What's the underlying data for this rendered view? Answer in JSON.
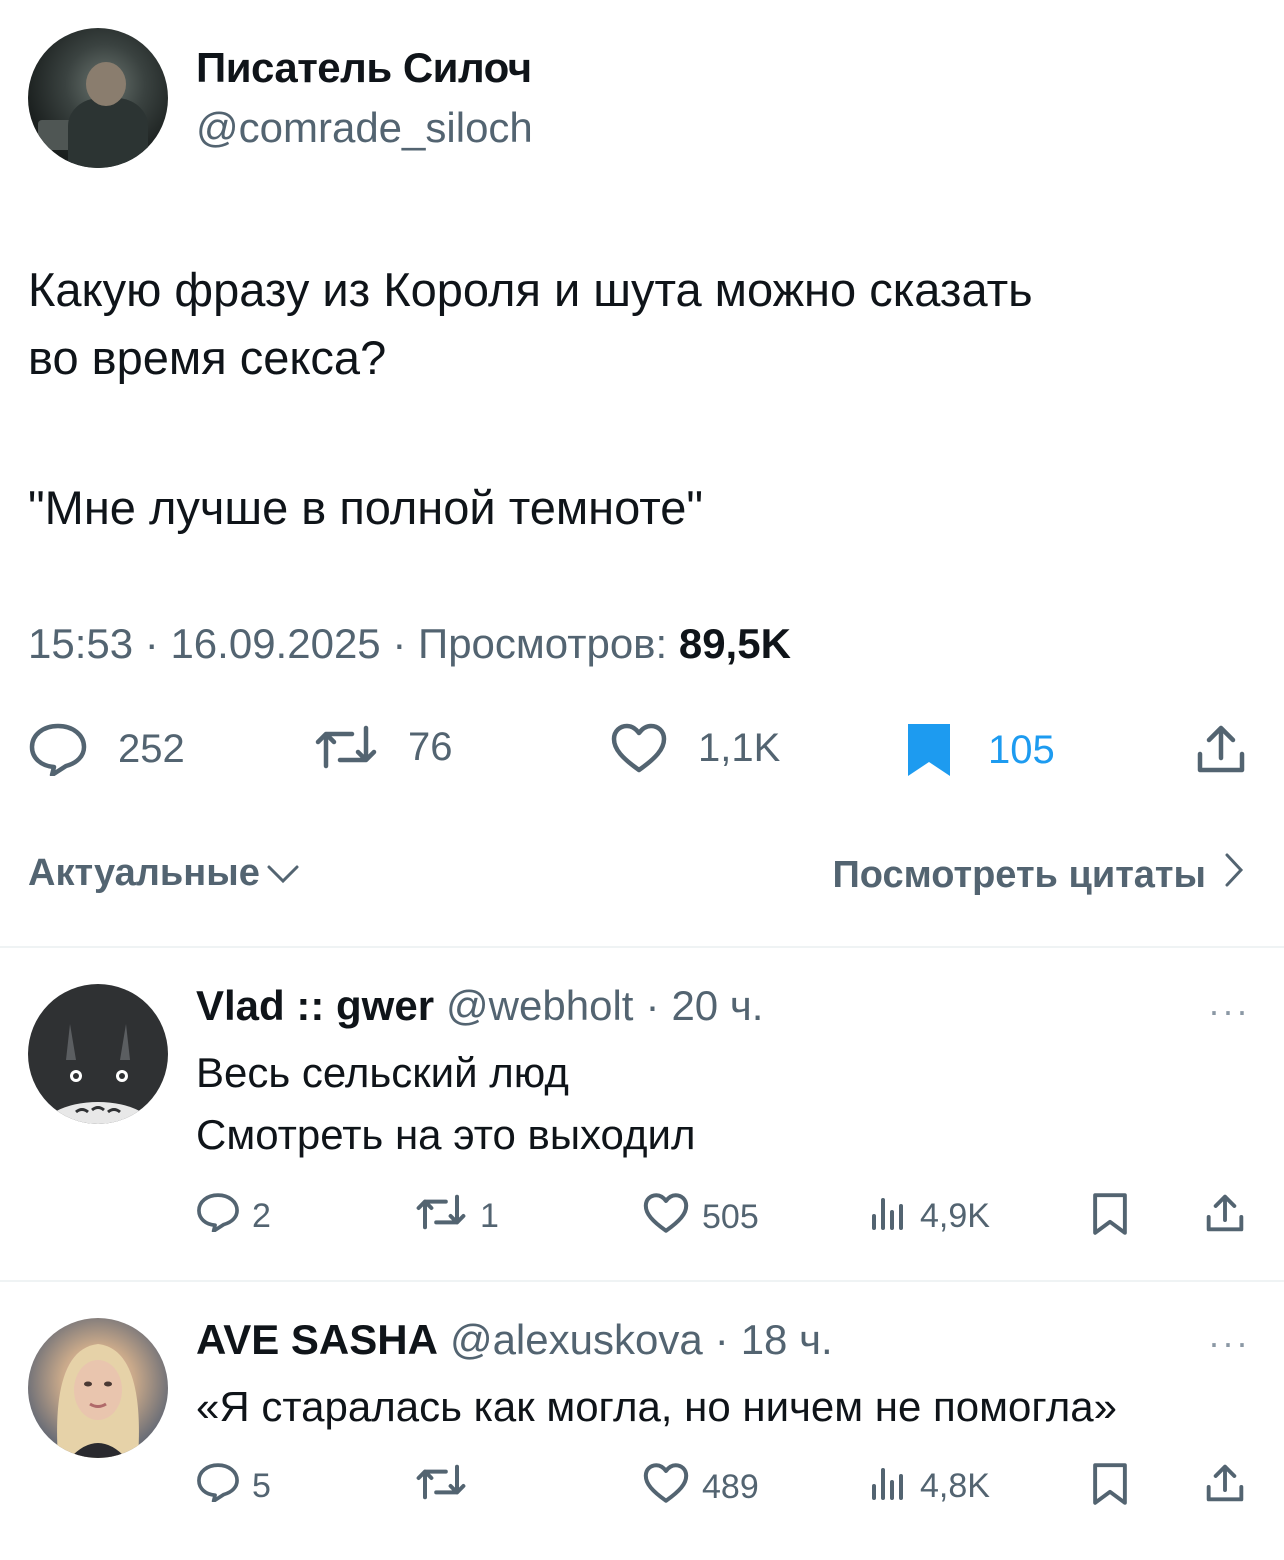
{
  "tweet": {
    "author_name": "Писатель Силоч",
    "author_handle": "@comrade_siloch",
    "text_line1": "Какую фразу из Короля и шута можно сказать",
    "text_line2": "во время секса?",
    "quote": "\"Мне лучше в полной темноте\"",
    "time": "15:53",
    "date": "16.09.2025",
    "views_label": "Просмотров:",
    "views_value": "89,5K",
    "sep": "·",
    "stats": {
      "replies": "252",
      "reposts": "76",
      "likes": "1,1K",
      "bookmarks": "105"
    }
  },
  "filters": {
    "sort_label": "Актуальные",
    "quotes_label": "Посмотреть цитаты"
  },
  "replies": [
    {
      "name": "Vlad :: gwer",
      "handle": "@webholt",
      "sep": "·",
      "time": "20 ч.",
      "line1": "Весь сельский люд",
      "line2": "Смотреть на это выходил",
      "more": "···",
      "stats": {
        "replies": "2",
        "reposts": "1",
        "likes": "505",
        "views": "4,9K"
      }
    },
    {
      "name": "AVE SASHA",
      "handle": "@alexuskova",
      "sep": "·",
      "time": "18 ч.",
      "line1": "«Я старалась как могла, но ничем не помогла»",
      "more": "···",
      "stats": {
        "replies": "5",
        "likes": "489",
        "views": "4,8K"
      }
    }
  ],
  "colors": {
    "text": "#0f1419",
    "muted": "#536471",
    "accent": "#1d9bf0",
    "divider": "#eff3f4"
  },
  "icons": [
    "reply-icon",
    "repost-icon",
    "like-icon",
    "bookmark-icon",
    "share-icon",
    "views-icon",
    "chevron-down-icon",
    "chevron-right-icon",
    "more-icon"
  ]
}
